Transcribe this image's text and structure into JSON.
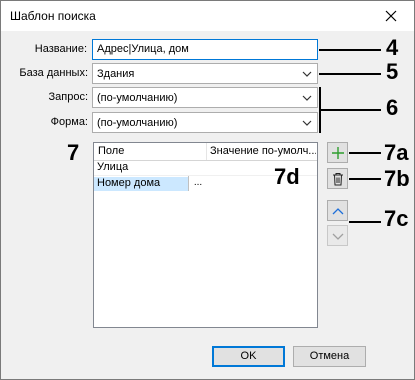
{
  "dialog": {
    "title": "Шаблон поиска"
  },
  "form": {
    "name_label": "Название:",
    "name_value": "Адрес|Улица, дом",
    "database_label": "База данных:",
    "database_value": "Здания",
    "query_label": "Запрос:",
    "query_value": "(по-умолчанию)",
    "form_label": "Форма:",
    "form_value": "(по-умолчанию)"
  },
  "grid": {
    "columns": [
      "Поле",
      "Значение по-умолч..."
    ],
    "rows": [
      {
        "field": "Улица",
        "value": "",
        "selected": false
      },
      {
        "field": "Номер дома",
        "value": "",
        "selected": true
      }
    ],
    "ellipsis": "..."
  },
  "buttons": {
    "ok": "OK",
    "cancel": "Отмена"
  },
  "side_buttons": [
    {
      "icon": "plus-icon",
      "color": "#2e9e2e",
      "enabled": true
    },
    {
      "icon": "trash-icon",
      "enabled": true
    },
    {
      "icon": "arrow-up-icon",
      "color": "#1e6fd9",
      "enabled": true
    },
    {
      "icon": "arrow-down-icon",
      "enabled": false
    }
  ],
  "annotations": {
    "a4": "4",
    "a5": "5",
    "a6": "6",
    "a7": "7",
    "a7a": "7a",
    "a7b": "7b",
    "a7c": "7c",
    "a7d": "7d"
  }
}
